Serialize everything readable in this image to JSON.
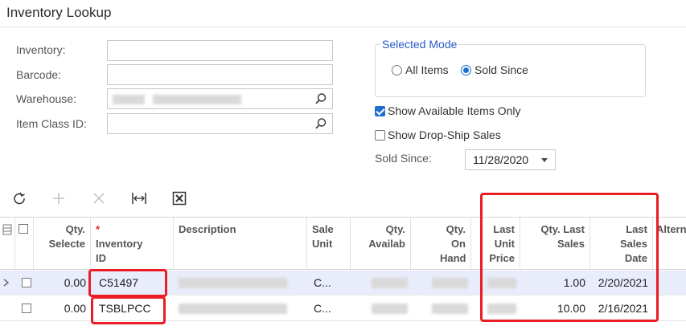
{
  "title": "Inventory Lookup",
  "form": {
    "inventory_label": "Inventory:",
    "inventory_value": "",
    "barcode_label": "Barcode:",
    "barcode_value": "",
    "warehouse_label": "Warehouse:",
    "item_class_label": "Item Class ID:",
    "item_class_value": ""
  },
  "selected_mode": {
    "legend": "Selected Mode",
    "options": [
      "All Items",
      "Sold Since"
    ],
    "selected": "Sold Since"
  },
  "options": {
    "show_available_label": "Show Available Items Only",
    "show_available_checked": true,
    "show_dropship_label": "Show Drop-Ship Sales",
    "show_dropship_checked": false
  },
  "sold_since": {
    "label": "Sold Since:",
    "value": "11/28/2020"
  },
  "toolbar": {
    "icons": [
      "refresh-icon",
      "add-icon",
      "delete-icon",
      "fit-columns-icon",
      "export-excel-icon"
    ]
  },
  "grid": {
    "headers": {
      "qty_selected": "Qty. Selecte",
      "inventory_id": "Inventory ID",
      "description": "Description",
      "sale_unit": "Sale Unit",
      "qty_available": "Qty. Availab",
      "qty_on_hand": "Qty. On Hand",
      "last_unit_price": "Last Unit Price",
      "qty_last_sales": "Qty. Last Sales",
      "last_sales_date": "Last Sales Date",
      "alternate": "Altern"
    },
    "rows": [
      {
        "qty_selected": "0.00",
        "inventory_id": "C51497",
        "sale_unit": "C...",
        "qty_last_sales": "1.00",
        "last_sales_date": "2/20/2021",
        "selected": true
      },
      {
        "qty_selected": "0.00",
        "inventory_id": "TSBLPCC",
        "sale_unit": "C...",
        "qty_last_sales": "10.00",
        "last_sales_date": "2/16/2021",
        "selected": false
      }
    ]
  },
  "colors": {
    "accent": "#1f6fd1",
    "legend": "#2a59c9",
    "highlight": "#ea1c24",
    "selected_row": "#e9ecfb"
  }
}
